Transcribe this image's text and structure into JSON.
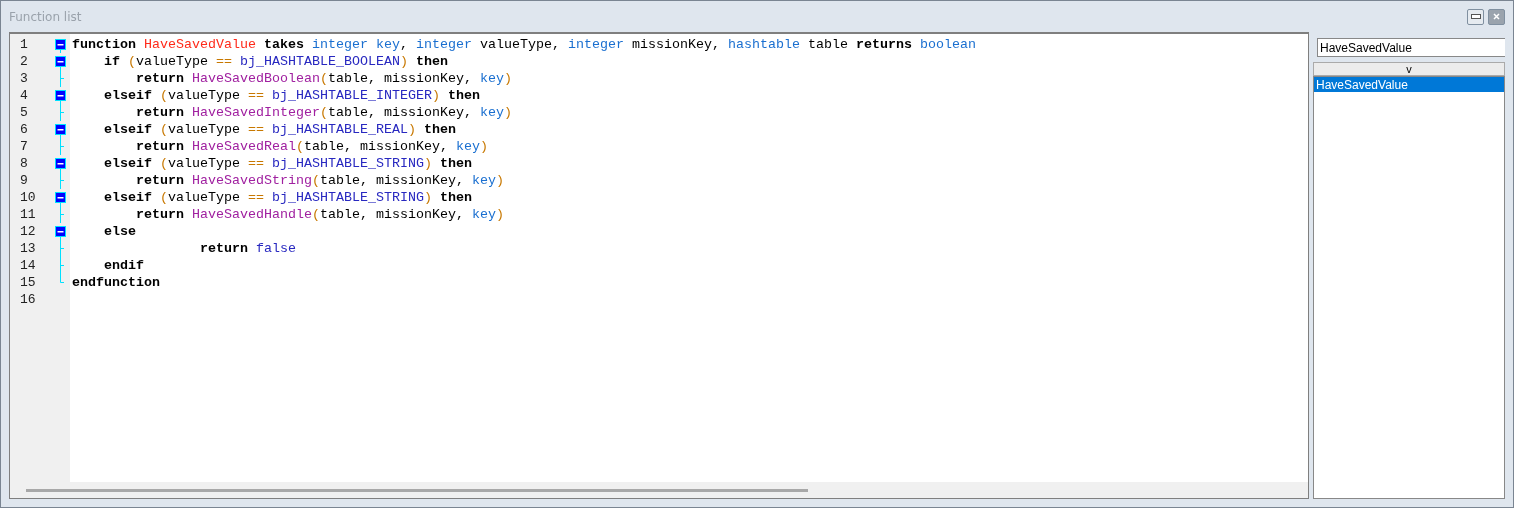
{
  "window": {
    "title": "Function list"
  },
  "editor": {
    "lines": [
      {
        "number": "1",
        "kind": "start",
        "tokens": [
          {
            "text": "function ",
            "kind": "keyword"
          },
          {
            "text": "HaveSavedValue",
            "kind": "name"
          },
          {
            "text": " takes ",
            "kind": "keyword"
          },
          {
            "text": "integer key",
            "kind": "type"
          },
          {
            "text": ", ",
            "kind": "plain"
          },
          {
            "text": "integer",
            "kind": "type"
          },
          {
            "text": " valueType, ",
            "kind": "plain"
          },
          {
            "text": "integer",
            "kind": "type"
          },
          {
            "text": " missionKey, ",
            "kind": "plain"
          },
          {
            "text": "hashtable",
            "kind": "type"
          },
          {
            "text": " table ",
            "kind": "plain"
          },
          {
            "text": "returns ",
            "kind": "keyword"
          },
          {
            "text": "boolean",
            "kind": "type"
          }
        ]
      },
      {
        "number": "2",
        "kind": "start",
        "tokens": [
          {
            "text": "    if ",
            "kind": "keyword"
          },
          {
            "text": "(",
            "kind": "op"
          },
          {
            "text": "valueType ",
            "kind": "plain"
          },
          {
            "text": "==",
            "kind": "op"
          },
          {
            "text": " bj_HASHTABLE_BOOLEAN",
            "kind": "const"
          },
          {
            "text": ")",
            "kind": "op"
          },
          {
            "text": " then",
            "kind": "keyword"
          }
        ]
      },
      {
        "number": "3",
        "kind": "inner",
        "tokens": [
          {
            "text": "        return ",
            "kind": "keyword"
          },
          {
            "text": "HaveSavedBoolean",
            "kind": "func"
          },
          {
            "text": "(",
            "kind": "op"
          },
          {
            "text": "table, missionKey, ",
            "kind": "plain"
          },
          {
            "text": "key",
            "kind": "type"
          },
          {
            "text": ")",
            "kind": "op"
          }
        ]
      },
      {
        "number": "4",
        "kind": "start",
        "tokens": [
          {
            "text": "    elseif ",
            "kind": "keyword"
          },
          {
            "text": "(",
            "kind": "op"
          },
          {
            "text": "valueType ",
            "kind": "plain"
          },
          {
            "text": "==",
            "kind": "op"
          },
          {
            "text": " bj_HASHTABLE_INTEGER",
            "kind": "const"
          },
          {
            "text": ")",
            "kind": "op"
          },
          {
            "text": " then",
            "kind": "keyword"
          }
        ]
      },
      {
        "number": "5",
        "kind": "inner",
        "tokens": [
          {
            "text": "        return ",
            "kind": "keyword"
          },
          {
            "text": "HaveSavedInteger",
            "kind": "func"
          },
          {
            "text": "(",
            "kind": "op"
          },
          {
            "text": "table, missionKey, ",
            "kind": "plain"
          },
          {
            "text": "key",
            "kind": "type"
          },
          {
            "text": ")",
            "kind": "op"
          }
        ]
      },
      {
        "number": "6",
        "kind": "start",
        "tokens": [
          {
            "text": "    elseif ",
            "kind": "keyword"
          },
          {
            "text": "(",
            "kind": "op"
          },
          {
            "text": "valueType ",
            "kind": "plain"
          },
          {
            "text": "==",
            "kind": "op"
          },
          {
            "text": " bj_HASHTABLE_REAL",
            "kind": "const"
          },
          {
            "text": ")",
            "kind": "op"
          },
          {
            "text": " then",
            "kind": "keyword"
          }
        ]
      },
      {
        "number": "7",
        "kind": "inner",
        "tokens": [
          {
            "text": "        return ",
            "kind": "keyword"
          },
          {
            "text": "HaveSavedReal",
            "kind": "func"
          },
          {
            "text": "(",
            "kind": "op"
          },
          {
            "text": "table, missionKey, ",
            "kind": "plain"
          },
          {
            "text": "key",
            "kind": "type"
          },
          {
            "text": ")",
            "kind": "op"
          }
        ]
      },
      {
        "number": "8",
        "kind": "start",
        "tokens": [
          {
            "text": "    elseif ",
            "kind": "keyword"
          },
          {
            "text": "(",
            "kind": "op"
          },
          {
            "text": "valueType ",
            "kind": "plain"
          },
          {
            "text": "==",
            "kind": "op"
          },
          {
            "text": " bj_HASHTABLE_STRING",
            "kind": "const"
          },
          {
            "text": ")",
            "kind": "op"
          },
          {
            "text": " then",
            "kind": "keyword"
          }
        ]
      },
      {
        "number": "9",
        "kind": "inner",
        "tokens": [
          {
            "text": "        return ",
            "kind": "keyword"
          },
          {
            "text": "HaveSavedString",
            "kind": "func"
          },
          {
            "text": "(",
            "kind": "op"
          },
          {
            "text": "table, missionKey, ",
            "kind": "plain"
          },
          {
            "text": "key",
            "kind": "type"
          },
          {
            "text": ")",
            "kind": "op"
          }
        ]
      },
      {
        "number": "10",
        "kind": "start",
        "tokens": [
          {
            "text": "    elseif ",
            "kind": "keyword"
          },
          {
            "text": "(",
            "kind": "op"
          },
          {
            "text": "valueType ",
            "kind": "plain"
          },
          {
            "text": "==",
            "kind": "op"
          },
          {
            "text": " bj_HASHTABLE_STRING",
            "kind": "const"
          },
          {
            "text": ")",
            "kind": "op"
          },
          {
            "text": " then",
            "kind": "keyword"
          }
        ]
      },
      {
        "number": "11",
        "kind": "inner",
        "tokens": [
          {
            "text": "        return ",
            "kind": "keyword"
          },
          {
            "text": "HaveSavedHandle",
            "kind": "func"
          },
          {
            "text": "(",
            "kind": "op"
          },
          {
            "text": "table, missionKey, ",
            "kind": "plain"
          },
          {
            "text": "key",
            "kind": "type"
          },
          {
            "text": ")",
            "kind": "op"
          }
        ]
      },
      {
        "number": "12",
        "kind": "start",
        "tokens": [
          {
            "text": "    else",
            "kind": "keyword"
          }
        ]
      },
      {
        "number": "13",
        "kind": "inner",
        "tokens": [
          {
            "text": "                return ",
            "kind": "keyword"
          },
          {
            "text": "false",
            "kind": "const"
          }
        ]
      },
      {
        "number": "14",
        "kind": "inner",
        "tokens": [
          {
            "text": "    endif",
            "kind": "keyword"
          }
        ]
      },
      {
        "number": "15",
        "kind": "end",
        "tokens": [
          {
            "text": "endfunction",
            "kind": "keyword"
          }
        ]
      },
      {
        "number": "16",
        "kind": "blank"
      }
    ]
  },
  "sidebar": {
    "search": {
      "value": "HaveSavedValue"
    },
    "toggle": "v",
    "items": [
      {
        "label": "HaveSavedValue",
        "selected": true
      }
    ]
  }
}
